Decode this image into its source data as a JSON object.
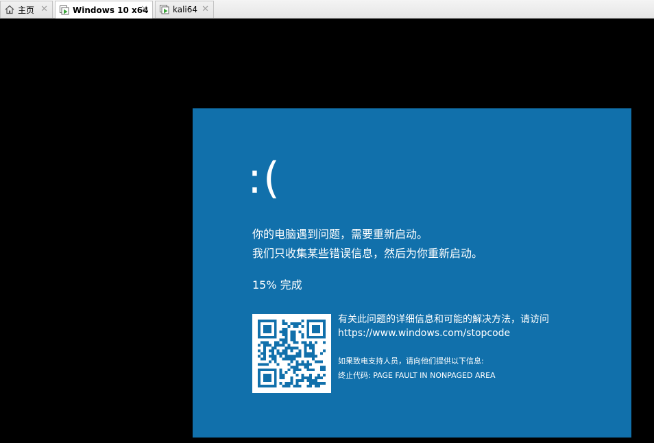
{
  "tabs": [
    {
      "label": "主页",
      "icon": "home-icon",
      "active": false
    },
    {
      "label": "Windows 10 x64",
      "icon": "vm-running-icon",
      "active": true
    },
    {
      "label": "kali64",
      "icon": "vm-running-icon",
      "active": false
    }
  ],
  "tab_close_glyph": "✕",
  "bsod": {
    "face": ":(",
    "line1": "你的电脑遇到问题，需要重新启动。",
    "line2": "我们只收集某些错误信息，然后为你重新启动。",
    "progress_text": "15% 完成",
    "progress_value": 15,
    "info_line1": "有关此问题的详细信息和可能的解决方法，请访问",
    "info_url": "https://www.windows.com/stopcode",
    "support_line": "如果致电支持人员，请向他们提供以下信息:",
    "stop_code_line": "终止代码: PAGE FAULT IN NONPAGED AREA",
    "qr_icon": "qr-code-icon"
  },
  "colors": {
    "bsod_blue": "#1170ab",
    "background": "#000000",
    "text": "#ffffff"
  }
}
